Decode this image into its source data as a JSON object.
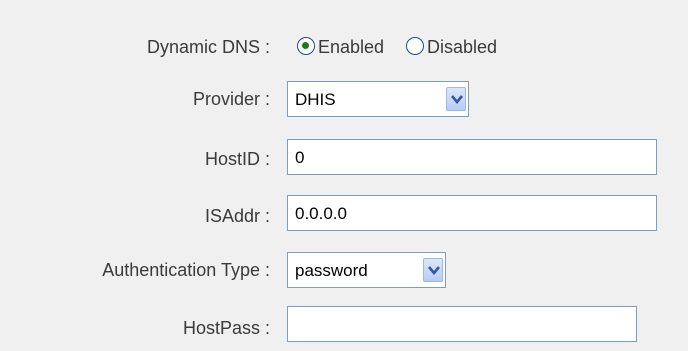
{
  "form": {
    "dynamic_dns": {
      "label": "Dynamic DNS :",
      "options": [
        "Enabled",
        "Disabled"
      ],
      "selected": "Enabled"
    },
    "provider": {
      "label": "Provider :",
      "value": "DHIS"
    },
    "hostid": {
      "label": "HostID :",
      "value": "0"
    },
    "isaddr": {
      "label": "ISAddr :",
      "value": "0.0.0.0"
    },
    "auth_type": {
      "label": "Authentication Type :",
      "value": "password"
    },
    "hostpass": {
      "label": "HostPass :",
      "value": ""
    }
  },
  "colors": {
    "background": "#f0f0f0",
    "field_border": "#7f9db9",
    "radio_dot": "#1a7b1a"
  },
  "icons": {
    "dropdown": "chevron-down-icon",
    "radio_selected": "radio-selected-icon",
    "radio_unselected": "radio-unselected-icon"
  }
}
